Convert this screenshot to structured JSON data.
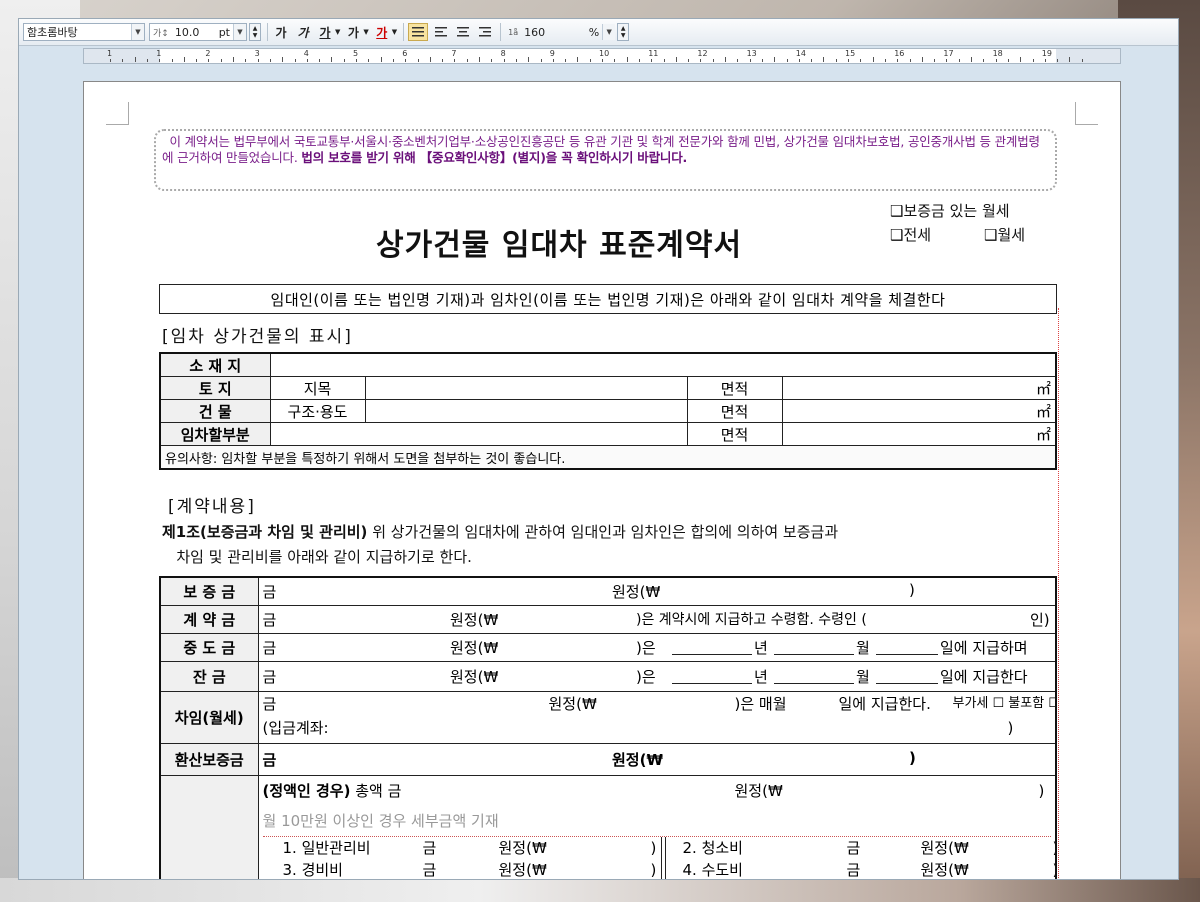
{
  "toolbar": {
    "font_name": "함초롬바탕",
    "font_size": "10.0",
    "size_unit": "pt",
    "size_prefix": "가↕",
    "bold": "가",
    "italic": "가",
    "underline": "가",
    "strike": "가",
    "color": "가",
    "line_spacing_label": "1ǟ",
    "line_spacing": "160",
    "line_spacing_unit": "%"
  },
  "ruler": {
    "numbers": [
      "1",
      "1",
      "2",
      "3",
      "4",
      "5",
      "6",
      "7",
      "8",
      "9",
      "10",
      "11",
      "12",
      "13",
      "14",
      "15",
      "16",
      "17",
      "18",
      "19"
    ]
  },
  "notice": {
    "text": "이 계약서는 법무부에서 국토교통부·서울시·중소벤처기업부·소상공인진흥공단 등 유관 기관 및 학계 전문가와 함께 민법, 상가건물 임대차보호법, 공인중개사법 등 관계법령에 근거하여 만들었습니다.",
    "bold": "법의 보호를 받기 위해 【중요확인사항】(별지)을 꼭 확인하시기 바랍니다."
  },
  "checkboxes": {
    "deposit_monthly": "❑보증금 있는 월세",
    "jeonse": "❑전세",
    "monthly": "❑월세"
  },
  "title": "상가건물 임대차 표준계약서",
  "intro": "임대인(이름 또는 법인명 기재)과 임차인(이름 또는 법인명 기재)은 아래와 같이 임대차 계약을 체결한다",
  "section1": "[임차 상가건물의 표시]",
  "property": {
    "location": "소 재 지",
    "land": "토    지",
    "land_sub": "지목",
    "building": "건    물",
    "building_sub": "구조·용도",
    "leased": "임차할부분",
    "area": "면적",
    "unit": "㎡",
    "note": "유의사항: 임차할 부분을 특정하기 위해서 도면을 첨부하는 것이 좋습니다."
  },
  "section2": "[계약내용]",
  "article1": {
    "title": "제1조(보증금과 차임 및 관리비)",
    "text": " 위 상가건물의 임대차에 관하여 임대인과 임차인은 합의에 의하여 보증금과",
    "text2": "차임 및 관리비를 아래와 같이 지급하기로 한다."
  },
  "terms": {
    "deposit": "보 증 금",
    "contract": "계 약 금",
    "middle": "중 도 금",
    "balance": "잔    금",
    "rent": "차임(월세)",
    "converted": "환산보증금",
    "geum": "금",
    "won_won": "원정(₩",
    "close": ")",
    "contract_tail": ")은 계약시에 지급하고 수령함. 수령인 (",
    "contract_in": "인)",
    "eun": ")은",
    "year": "년",
    "month": "월",
    "middle_tail": "일에 지급하며",
    "balance_tail": "일에 지급한다",
    "rent_eun": ")은  매월",
    "rent_tail": "일에 지급한다.",
    "vat": "부가세 ☐ 불포함  ☐ 포함",
    "account": "(입금계좌:",
    "fixed": "(정액인 경우)",
    "total": " 총액 금",
    "over10": "월 10만원 이상인 경우 세부금액 기재",
    "general": "1. 일반관리비",
    "cleaning": "2. 청소비",
    "heating": "3. 경비비",
    "water": "4. 수도비"
  }
}
